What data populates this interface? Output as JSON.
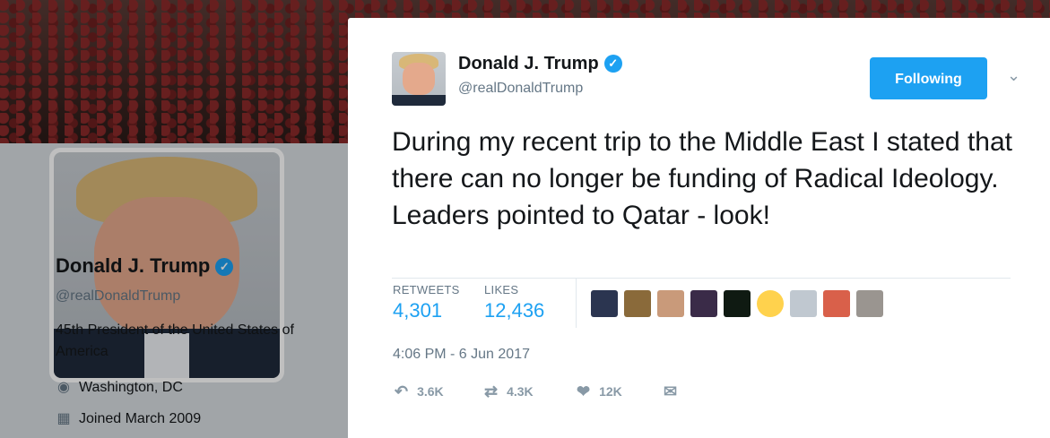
{
  "profile": {
    "name": "Donald J. Trump",
    "handle": "@realDonaldTrump",
    "bio": "45th President of the United States of America",
    "location": "Washington, DC",
    "joined": "Joined March 2009"
  },
  "tweet": {
    "author_name": "Donald J. Trump",
    "author_handle": "@realDonaldTrump",
    "follow_label": "Following",
    "text": "During my recent trip to the Middle East I stated that there can no longer be funding of Radical Ideology. Leaders pointed to Qatar - look!",
    "retweets_label": "RETWEETS",
    "retweets_value": "4,301",
    "likes_label": "LIKES",
    "likes_value": "12,436",
    "timestamp": "4:06 PM - 6 Jun 2017",
    "actions": {
      "reply_count": "3.6K",
      "retweet_count": "4.3K",
      "like_count": "12K"
    }
  },
  "icons": {
    "verified": "verified-badge-icon",
    "location": "map-pin-icon",
    "calendar": "calendar-icon",
    "chevron": "chevron-down-icon",
    "reply": "reply-icon",
    "retweet": "retweet-icon",
    "like": "heart-icon",
    "message": "direct-message-icon"
  },
  "colors": {
    "accent": "#1da1f2",
    "text": "#14171a",
    "muted": "#657786"
  }
}
